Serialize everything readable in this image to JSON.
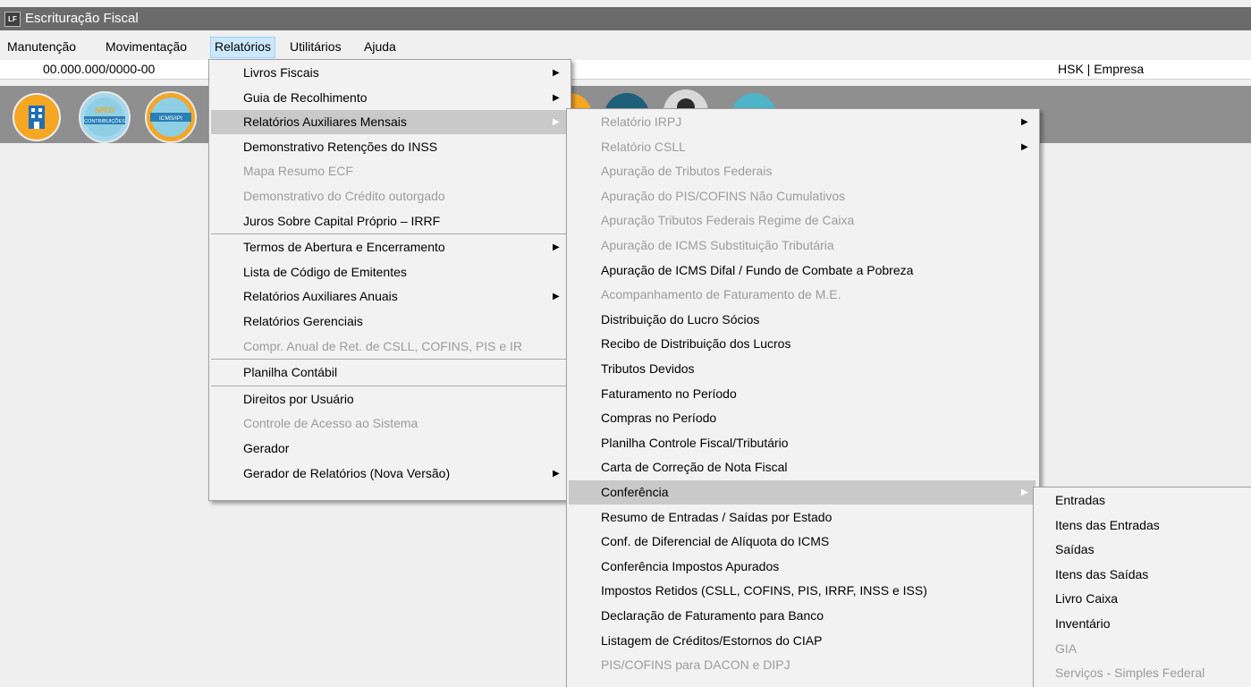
{
  "window": {
    "title": "Escrituração Fiscal",
    "icon_text": "LF"
  },
  "menubar": {
    "items": [
      "Manutenção",
      "Movimentação",
      "Relatórios",
      "Utilitários",
      "Ajuda"
    ],
    "active": "Relatórios"
  },
  "infobar": {
    "cnpj": "00.000.000/0000-00",
    "company": "HSK | Empresa"
  },
  "toolbar": {
    "icons": [
      "building-icon",
      "sped-contribuicoes-icon",
      "icms-ipi-icon"
    ],
    "sped_text": "SPED",
    "sped_sub": "CONTRIBUIÇÕES",
    "icms_text": "ICMS/IPI"
  },
  "menu1": {
    "items": [
      {
        "label": "Livros Fiscais",
        "enabled": true,
        "submenu": true
      },
      {
        "label": "Guia de Recolhimento",
        "enabled": true,
        "submenu": true
      },
      {
        "label": "Relatórios Auxiliares Mensais",
        "enabled": true,
        "submenu": true,
        "highlighted": true
      },
      {
        "label": "Demonstrativo Retenções do INSS",
        "enabled": true
      },
      {
        "label": "Mapa Resumo ECF",
        "enabled": false
      },
      {
        "label": "Demonstrativo do Crédito outorgado",
        "enabled": false
      },
      {
        "label": "Juros Sobre Capital Próprio – IRRF",
        "enabled": true
      },
      {
        "label": "Termos de Abertura e Encerramento",
        "enabled": true,
        "submenu": true
      },
      {
        "label": "Lista de Código de Emitentes",
        "enabled": true
      },
      {
        "label": "Relatórios Auxiliares Anuais",
        "enabled": true,
        "submenu": true
      },
      {
        "label": "Relatórios Gerenciais",
        "enabled": true
      },
      {
        "label": "Compr. Anual de Ret. de CSLL, COFINS,  PIS e IR",
        "enabled": false
      },
      {
        "label": "Planilha Contábil",
        "enabled": true
      },
      {
        "label": "Direitos por Usuário",
        "enabled": true
      },
      {
        "label": "Controle de Acesso ao Sistema",
        "enabled": false
      },
      {
        "label": "Gerador",
        "enabled": true
      },
      {
        "label": "Gerador de Relatórios (Nova Versão)",
        "enabled": true,
        "submenu": true
      }
    ]
  },
  "menu2": {
    "items": [
      {
        "label": "Relatório IRPJ",
        "enabled": false,
        "submenu": true
      },
      {
        "label": "Relatório CSLL",
        "enabled": false,
        "submenu": true
      },
      {
        "label": "Apuração de Tributos Federais",
        "enabled": false
      },
      {
        "label": "Apuração do PIS/COFINS Não Cumulativos",
        "enabled": false
      },
      {
        "label": "Apuração Tributos Federais Regime de Caixa",
        "enabled": false
      },
      {
        "label": "Apuração de ICMS Substituição Tributária",
        "enabled": false
      },
      {
        "label": "Apuração de ICMS Difal / Fundo de Combate a Pobreza",
        "enabled": true
      },
      {
        "label": "Acompanhamento de Faturamento de M.E.",
        "enabled": false
      },
      {
        "label": "Distribuição do Lucro Sócios",
        "enabled": true
      },
      {
        "label": "Recibo de Distribuição dos Lucros",
        "enabled": true
      },
      {
        "label": "Tributos Devidos",
        "enabled": true
      },
      {
        "label": "Faturamento no Período",
        "enabled": true
      },
      {
        "label": "Compras no Período",
        "enabled": true
      },
      {
        "label": "Planilha Controle Fiscal/Tributário",
        "enabled": true
      },
      {
        "label": "Carta de Correção de Nota Fiscal",
        "enabled": true
      },
      {
        "label": "Conferência",
        "enabled": true,
        "submenu": true,
        "highlighted": true
      },
      {
        "label": "Resumo de Entradas / Saídas por Estado",
        "enabled": true
      },
      {
        "label": "Conf. de Diferencial de Alíquota do ICMS",
        "enabled": true
      },
      {
        "label": "Conferência Impostos Apurados",
        "enabled": true
      },
      {
        "label": "Impostos Retidos (CSLL, COFINS,  PIS, IRRF, INSS e ISS)",
        "enabled": true
      },
      {
        "label": "Declaração de Faturamento para Banco",
        "enabled": true
      },
      {
        "label": "Listagem de Créditos/Estornos do CIAP",
        "enabled": true
      },
      {
        "label": "PIS/COFINS para DACON e DIPJ",
        "enabled": false
      }
    ]
  },
  "menu3": {
    "items": [
      {
        "label": "Entradas",
        "enabled": true
      },
      {
        "label": "Itens das Entradas",
        "enabled": true
      },
      {
        "label": "Saídas",
        "enabled": true
      },
      {
        "label": "Itens das Saídas",
        "enabled": true
      },
      {
        "label": "Livro Caixa",
        "enabled": true
      },
      {
        "label": "Inventário",
        "enabled": true
      },
      {
        "label": "GIA",
        "enabled": false
      },
      {
        "label": "Serviços - Simples Federal",
        "enabled": false
      }
    ]
  },
  "colors": {
    "titlebar": "#6b6b6b",
    "toolbar": "#8f8f8f",
    "menu_bg": "#f2f2f2",
    "highlight": "#c9c9c9",
    "disabled_text": "#9c9c9c",
    "active_menu": "#cce8ff"
  }
}
